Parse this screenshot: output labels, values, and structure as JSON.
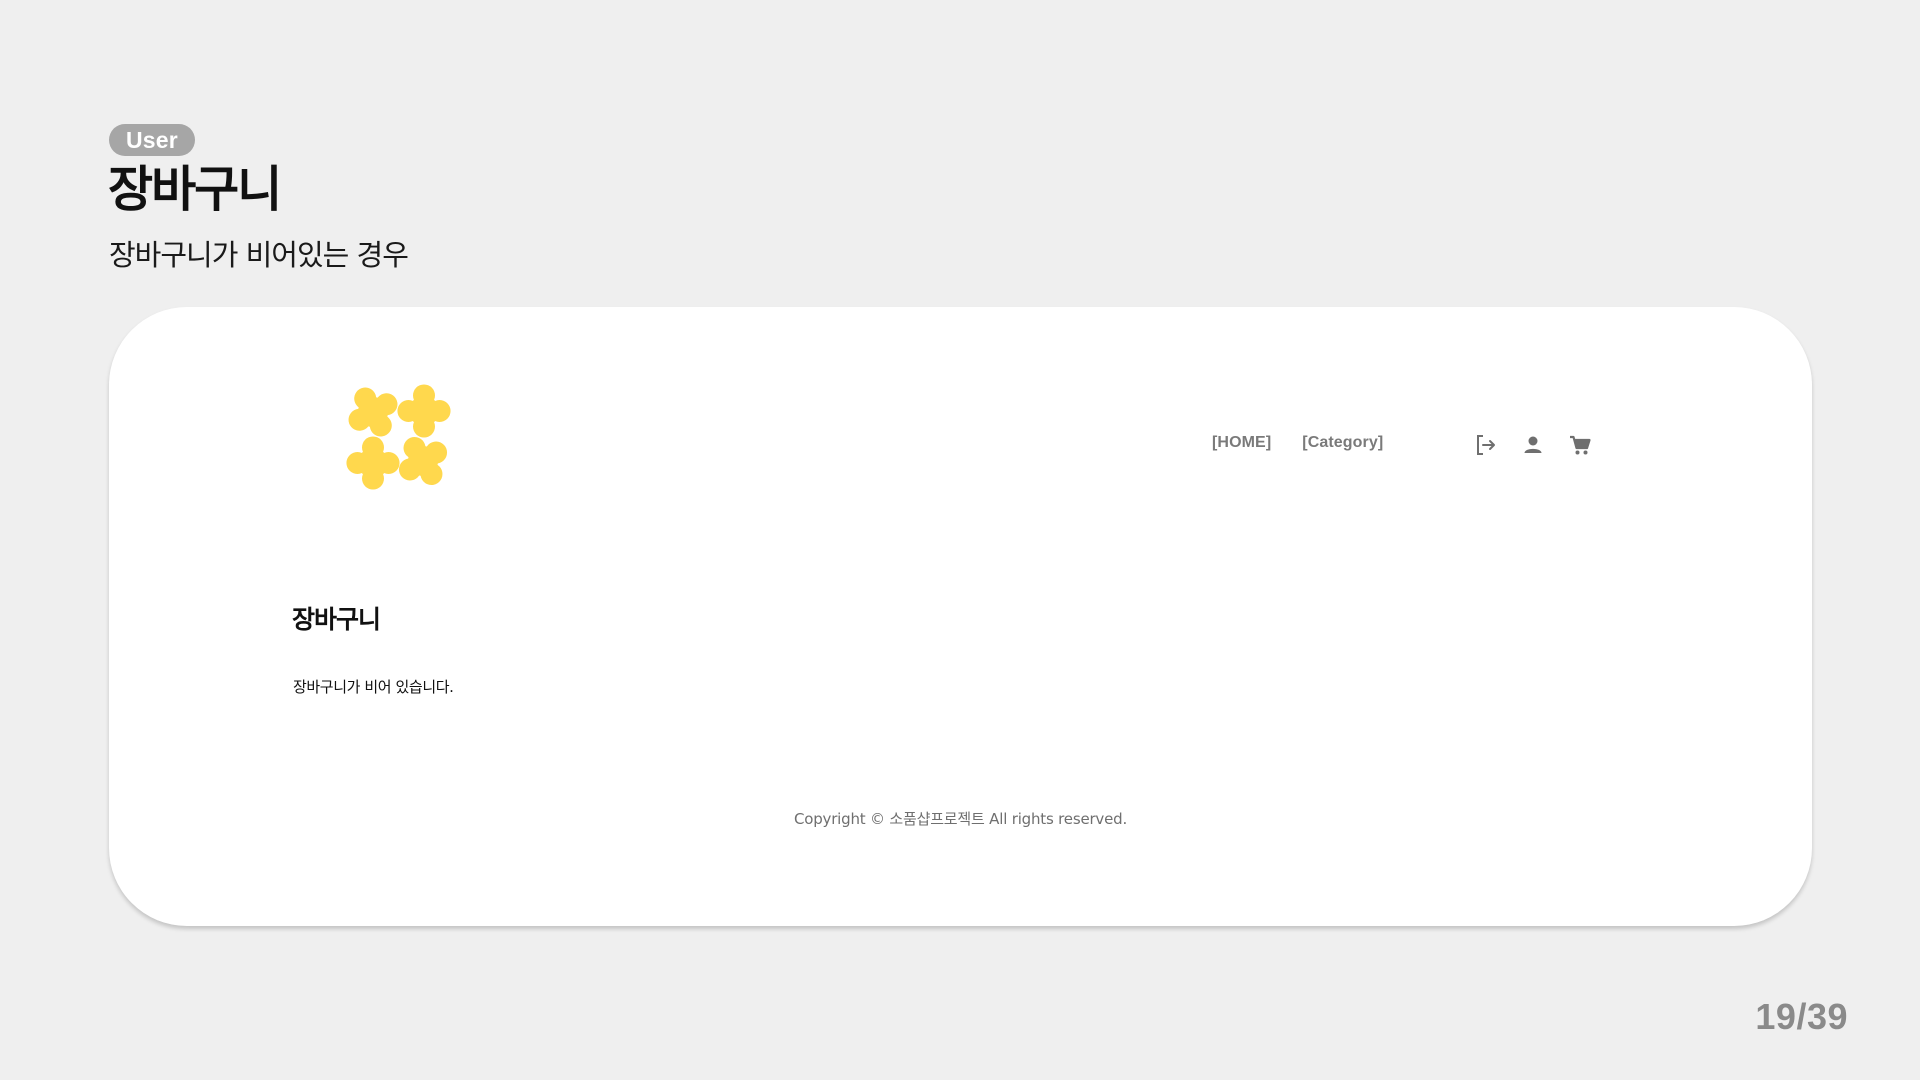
{
  "slide": {
    "role_badge": "User",
    "title": "장바구니",
    "subtitle": "장바구니가 비어있는 경우",
    "page_number": "19/39"
  },
  "mockup": {
    "logo": {
      "icon": "clover-blossom-logo",
      "color": "#FFD84D"
    },
    "nav": {
      "home_label": "[HOME]",
      "category_label": "[Category]"
    },
    "icons": {
      "logout": "logout-icon",
      "user": "user-icon",
      "cart": "cart-icon",
      "color": "#6f6f6f"
    },
    "cart": {
      "heading": "장바구니",
      "empty_message": "장바구니가 비어 있습니다."
    },
    "footer": {
      "copyright": "Copyright © 소품샵프로젝트 All rights reserved."
    }
  },
  "colors": {
    "background": "#efefef",
    "badge": "#a6a6a6",
    "card": "#ffffff"
  }
}
